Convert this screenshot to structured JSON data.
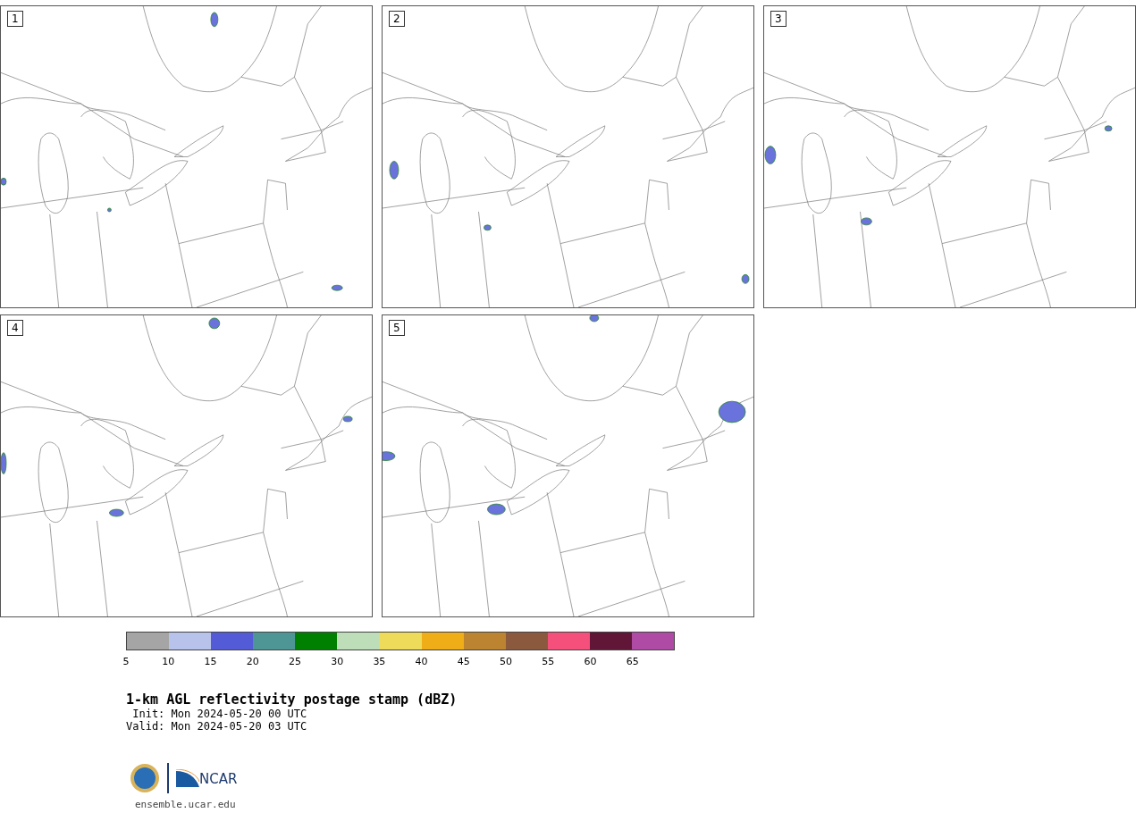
{
  "panels": [
    {
      "label": "1"
    },
    {
      "label": "2"
    },
    {
      "label": "3"
    },
    {
      "label": "4"
    },
    {
      "label": "5"
    }
  ],
  "colorbar": {
    "bins": [
      {
        "color": "#a5a5a5"
      },
      {
        "color": "#b8c3ec"
      },
      {
        "color": "#535bd6"
      },
      {
        "color": "#4e9696"
      },
      {
        "color": "#008000"
      },
      {
        "color": "#bedeb9"
      },
      {
        "color": "#eedb5a"
      },
      {
        "color": "#efad17"
      },
      {
        "color": "#bc8331"
      },
      {
        "color": "#8b5a3e"
      },
      {
        "color": "#f5507b"
      },
      {
        "color": "#611537"
      },
      {
        "color": "#af4ba5"
      }
    ],
    "ticks": [
      "5",
      "10",
      "15",
      "20",
      "25",
      "30",
      "35",
      "40",
      "45",
      "50",
      "55",
      "60",
      "65"
    ]
  },
  "title": "1-km AGL reflectivity postage stamp (dBZ)",
  "init": " Init: Mon 2024-05-20 00 UTC",
  "valid": "Valid: Mon 2024-05-20 03 UTC",
  "logo": {
    "text": "NCAR"
  },
  "url": "ensemble.ucar.edu"
}
